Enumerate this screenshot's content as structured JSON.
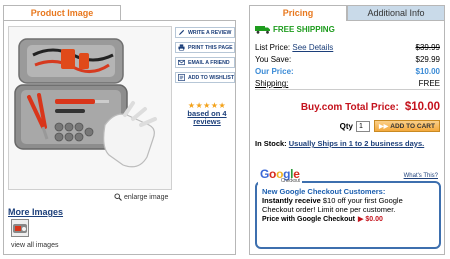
{
  "left": {
    "tab_label": "Product Image",
    "actions": [
      {
        "label": "WRITE A REVIEW",
        "icon": "pencil-icon"
      },
      {
        "label": "PRINT THIS PAGE",
        "icon": "printer-icon"
      },
      {
        "label": "EMAIL A FRIEND",
        "icon": "envelope-icon"
      },
      {
        "label": "ADD TO WISHLIST",
        "icon": "wishlist-icon"
      }
    ],
    "stars": "★★★★★",
    "rating_link": "based on 4 reviews",
    "enlarge_label": "enlarge image",
    "more_images_title": "More Images",
    "view_all_label": "view all images"
  },
  "right": {
    "tabs": {
      "pricing": "Pricing",
      "info": "Additional Info"
    },
    "free_shipping": "FREE SHIPPING",
    "list_price_label": "List Price:",
    "see_details": "See Details",
    "list_price_value": "$39.99",
    "you_save_label": "You Save:",
    "you_save_value": "$29.99",
    "our_price_label": "Our Price:",
    "our_price_value": "$10.00",
    "shipping_label": "Shipping:",
    "shipping_value": "FREE",
    "total_label": "Buy.com Total Price:",
    "total_value": "$10.00",
    "qty_label": "Qty",
    "qty_value": "1",
    "add_to_cart_label": "ADD TO CART",
    "in_stock_label": "In Stock:",
    "in_stock_link": "Usually Ships in 1 to 2 business days.",
    "google": {
      "logo": "Google",
      "logo_sub": "Checkout",
      "whats_this": "What's This?",
      "heading": "New Google Checkout Customers:",
      "body_bold": "Instantly receive",
      "body_rest": " $10 off your first Google Checkout order! Limit one per customer.",
      "price_label": "Price with Google Checkout",
      "price_value": "$0.00"
    }
  },
  "colors": {
    "accent_orange": "#e8781e",
    "link_blue": "#1c3f7a",
    "price_blue": "#3b8bd6",
    "total_red": "#c4121c",
    "free_green": "#1e9c1e"
  }
}
